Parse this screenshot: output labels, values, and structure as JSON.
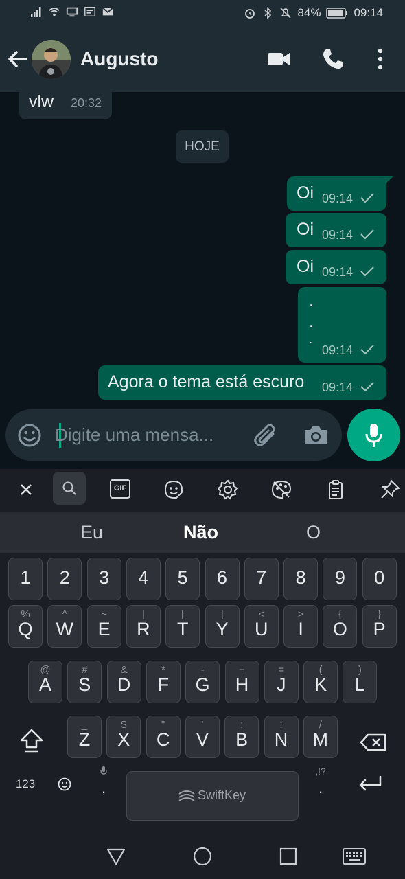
{
  "status": {
    "battery": "84%",
    "time": "09:14"
  },
  "header": {
    "contact_name": "Augusto"
  },
  "chat": {
    "day_chip": "HOJE",
    "incoming": [
      {
        "text": "vlw",
        "time": "20:32"
      }
    ],
    "outgoing": [
      {
        "text": "Oi",
        "time": "09:14"
      },
      {
        "text": "Oi",
        "time": "09:14"
      },
      {
        "text": "Oi",
        "time": "09:14"
      },
      {
        "lines": [
          ".",
          ".",
          "."
        ],
        "time": "09:14"
      },
      {
        "text": "Agora o tema está escuro",
        "time": "09:14"
      }
    ]
  },
  "composer": {
    "placeholder": "Digite uma mensa..."
  },
  "keyboard": {
    "toolbar": {
      "gif_label": "GIF"
    },
    "suggestions": [
      "Eu",
      "Não",
      "O"
    ],
    "number_row": [
      "1",
      "2",
      "3",
      "4",
      "5",
      "6",
      "7",
      "8",
      "9",
      "0"
    ],
    "row1": [
      {
        "key": "Q",
        "hint": "%"
      },
      {
        "key": "W",
        "hint": "^"
      },
      {
        "key": "E",
        "hint": "~"
      },
      {
        "key": "R",
        "hint": "|"
      },
      {
        "key": "T",
        "hint": "["
      },
      {
        "key": "Y",
        "hint": "]"
      },
      {
        "key": "U",
        "hint": "<"
      },
      {
        "key": "I",
        "hint": ">"
      },
      {
        "key": "O",
        "hint": "{"
      },
      {
        "key": "P",
        "hint": "}"
      }
    ],
    "row2": [
      {
        "key": "A",
        "hint": "@"
      },
      {
        "key": "S",
        "hint": "#"
      },
      {
        "key": "D",
        "hint": "&"
      },
      {
        "key": "F",
        "hint": "*"
      },
      {
        "key": "G",
        "hint": "-"
      },
      {
        "key": "H",
        "hint": "+"
      },
      {
        "key": "J",
        "hint": "="
      },
      {
        "key": "K",
        "hint": "("
      },
      {
        "key": "L",
        "hint": ")"
      }
    ],
    "row3": [
      {
        "key": "Z",
        "hint": "_"
      },
      {
        "key": "X",
        "hint": "$"
      },
      {
        "key": "C",
        "hint": "\""
      },
      {
        "key": "V",
        "hint": "'"
      },
      {
        "key": "B",
        "hint": ":"
      },
      {
        "key": "N",
        "hint": ";"
      },
      {
        "key": "M",
        "hint": "/"
      }
    ],
    "numbers_key": "123",
    "comma": ",",
    "period": ".",
    "period_hint": ",!?",
    "space_brand": "SwiftKey"
  }
}
